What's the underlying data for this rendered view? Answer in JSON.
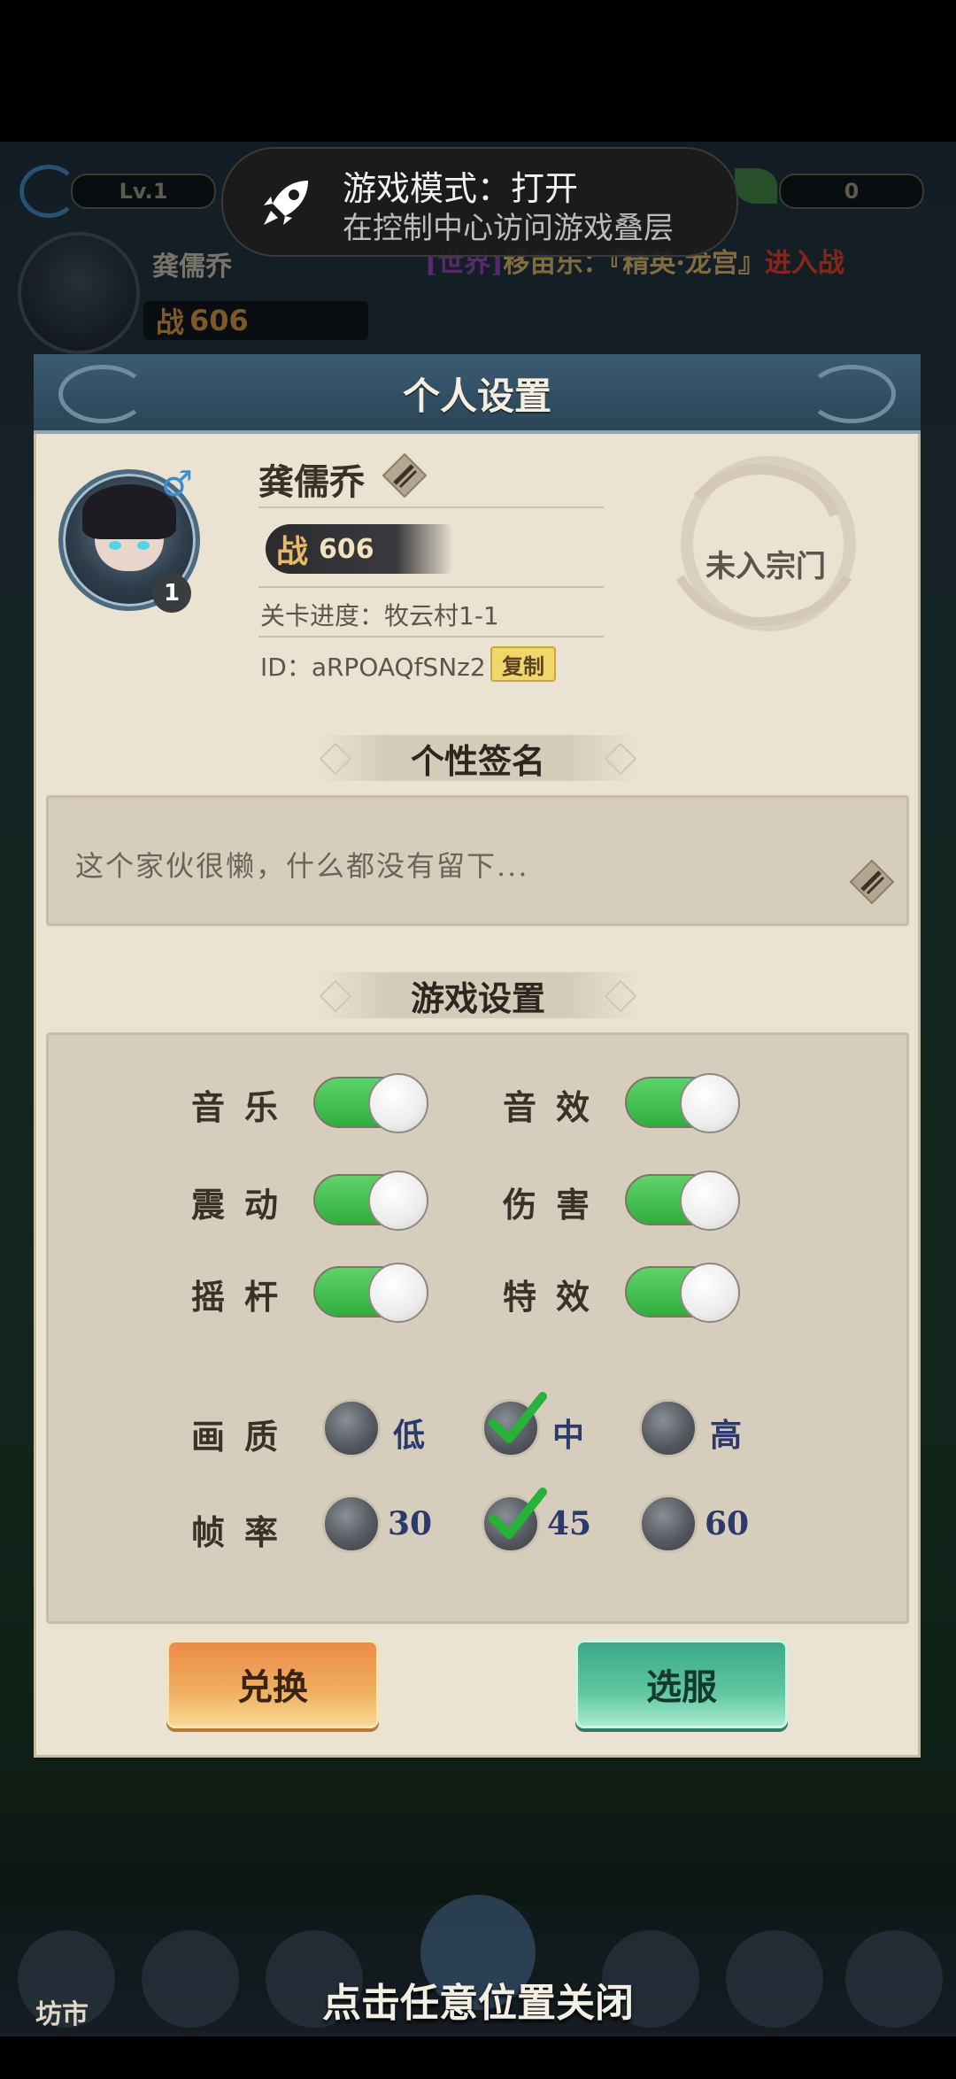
{
  "hud": {
    "level": "Lv.1",
    "currency": "0",
    "player_name": "龚儒乔",
    "power_label": "战",
    "power_value": "606",
    "news_channel": "[世界]",
    "news_text": "移亩乐：『精英·龙宫』",
    "news_tail": "进入战"
  },
  "toast": {
    "title": "游戏模式：打开",
    "subtitle": "在控制中心访问游戏叠层"
  },
  "panel": {
    "title": "个人设置",
    "profile": {
      "name": "龚儒乔",
      "level": "1",
      "power_label": "战",
      "power_value": "606",
      "stage": "关卡进度：牧云村1-1",
      "id": "ID：aRPOAQfSNz2",
      "copy_label": "复制",
      "sect": "未入宗门"
    },
    "signature": {
      "section_title": "个性签名",
      "text": "这个家伙很懒，什么都没有留下..."
    },
    "settings": {
      "section_title": "游戏设置",
      "toggles": [
        {
          "label": "音乐",
          "on": true
        },
        {
          "label": "音效",
          "on": true
        },
        {
          "label": "震动",
          "on": true
        },
        {
          "label": "伤害",
          "on": true
        },
        {
          "label": "摇杆",
          "on": true
        },
        {
          "label": "特效",
          "on": true
        }
      ],
      "quality": {
        "label": "画质",
        "options": [
          "低",
          "中",
          "高"
        ],
        "selected": "中"
      },
      "framerate": {
        "label": "帧率",
        "options": [
          "30",
          "45",
          "60"
        ],
        "selected": "45"
      }
    },
    "buttons": {
      "exchange": "兑换",
      "server": "选服"
    }
  },
  "bottom": {
    "market": "坊市",
    "close_hint": "点击任意位置关闭"
  },
  "colors": {
    "toggle_on": "#2fae3d",
    "panel_bg": "#ebe3d2",
    "header_bg": "#2b4457"
  }
}
